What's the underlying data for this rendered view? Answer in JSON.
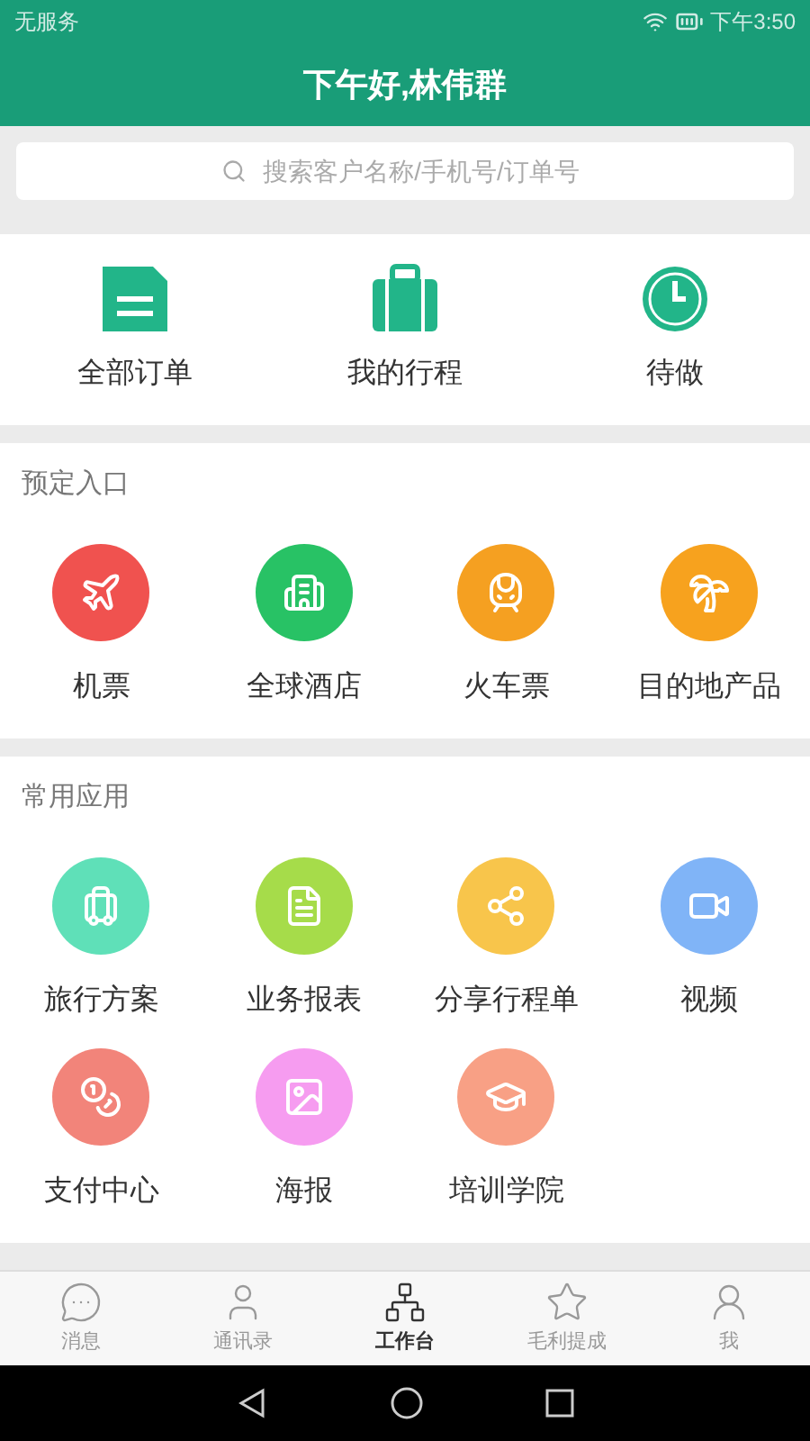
{
  "status_bar": {
    "carrier": "无服务",
    "time": "下午3:50"
  },
  "header": {
    "title": "下午好,林伟群"
  },
  "search": {
    "placeholder": "搜索客户名称/手机号/订单号"
  },
  "quick_actions": [
    {
      "kind": "document",
      "label": "全部订单"
    },
    {
      "kind": "suitcase",
      "label": "我的行程"
    },
    {
      "kind": "clock",
      "label": "待做"
    }
  ],
  "sections": [
    {
      "title": "预定入口",
      "items": [
        {
          "kind": "plane",
          "label": "机票",
          "color": "#f0524f"
        },
        {
          "kind": "hotel",
          "label": "全球酒店",
          "color": "#28c265"
        },
        {
          "kind": "train",
          "label": "火车票",
          "color": "#f5a021"
        },
        {
          "kind": "palm",
          "label": "目的地产品",
          "color": "#f7a21e"
        }
      ]
    },
    {
      "title": "常用应用",
      "items": [
        {
          "kind": "luggage",
          "label": "旅行方案",
          "color": "#5fe0b8"
        },
        {
          "kind": "report",
          "label": "业务报表",
          "color": "#a6dc4a"
        },
        {
          "kind": "share",
          "label": "分享行程单",
          "color": "#f8c54b"
        },
        {
          "kind": "video",
          "label": "视频",
          "color": "#80b4f7"
        },
        {
          "kind": "coins",
          "label": "支付中心",
          "color": "#f2847a"
        },
        {
          "kind": "image",
          "label": "海报",
          "color": "#f69cf0"
        },
        {
          "kind": "cap",
          "label": "培训学院",
          "color": "#f8a085"
        }
      ]
    }
  ],
  "tab_bar": [
    {
      "kind": "chat",
      "label": "消息",
      "selected": false
    },
    {
      "kind": "contact",
      "label": "通讯录",
      "selected": false
    },
    {
      "kind": "org",
      "label": "工作台",
      "selected": true
    },
    {
      "kind": "star",
      "label": "毛利提成",
      "selected": false
    },
    {
      "kind": "user",
      "label": "我",
      "selected": false
    }
  ]
}
